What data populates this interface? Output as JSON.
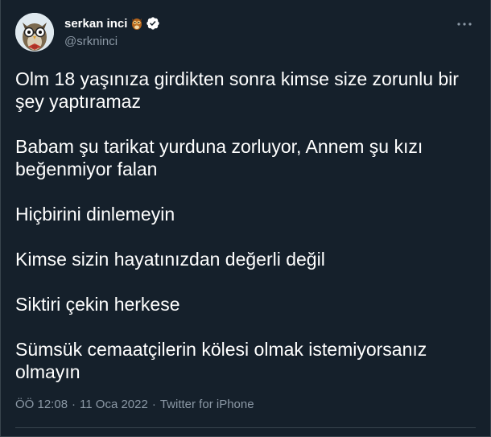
{
  "author": {
    "display_name": "serkan inci",
    "handle": "@srkninci",
    "name_emoji": "owl-emoji",
    "verified_badge": "verified-badge-icon"
  },
  "tweet": {
    "paragraphs": [
      "Olm 18 yaşınıza girdikten sonra kimse size zorunlu bir şey yaptıramaz",
      "Babam şu tarikat yurduna zorluyor, Annem şu kızı beğenmiyor falan",
      "Hiçbirini dinlemeyin",
      "Kimse sizin hayatınızdan değerli değil",
      "Siktiri çekin herkese",
      "Sümsük cemaatçilerin kölesi olmak istemiyorsanız olmayın"
    ]
  },
  "meta": {
    "time": "ÖÖ 12:08",
    "separator": "·",
    "date": "11 Oca 2022",
    "source": "Twitter for iPhone"
  },
  "colors": {
    "background": "#15202b",
    "text": "#ffffff",
    "secondary_text": "#8b98a5",
    "border": "#38444d",
    "verified_blue": "#ffffff"
  },
  "icons": {
    "more": "more-dots-icon",
    "avatar": "owl-avatar"
  }
}
